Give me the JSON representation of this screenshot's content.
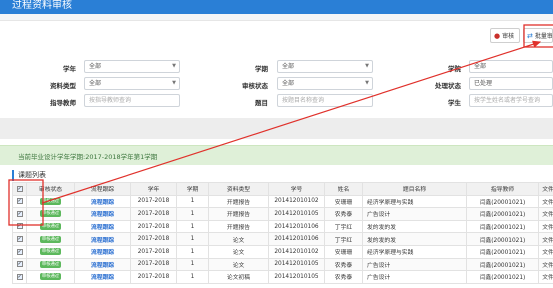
{
  "page": {
    "title": "过程资料审核"
  },
  "toolbar": {
    "review_label": "审核",
    "batch_label": "批量审核",
    "review_icon": "drop-icon",
    "batch_icon": "swap-icon"
  },
  "filters": {
    "year_label": "学年",
    "year_value": "全部",
    "term_label": "学期",
    "term_value": "全部",
    "college_label": "学院",
    "college_value": "全部",
    "type_label": "资料类型",
    "type_value": "全部",
    "status_label": "审核状态",
    "status_value": "全部",
    "handle_label": "处理状态",
    "handle_value": "已处理",
    "teacher_label": "指导教师",
    "teacher_placeholder": "按指导教师查询",
    "topic_label": "题目",
    "topic_placeholder": "按题目名称查询",
    "student_label": "学生",
    "student_placeholder": "按学生姓名或者学号查询"
  },
  "banner": {
    "text": "当前毕业设计学年学期:2017-2018学年第1学期"
  },
  "list": {
    "title": "课题列表"
  },
  "table": {
    "headers": [
      "",
      "审核状态",
      "流程跟踪",
      "学年",
      "学期",
      "资料类型",
      "学号",
      "姓名",
      "题目名称",
      "指导教师",
      "文件"
    ],
    "rows": [
      {
        "status": "审核通过",
        "track": "流程跟踪",
        "year": "2017-2018",
        "term": "1",
        "type": "开题报告",
        "sid": "201412010102",
        "name": "安珊珊",
        "topic": "经济学原理与实践",
        "teacher": "闫鑫(20001021)",
        "file": "文件"
      },
      {
        "status": "审核通过",
        "track": "流程跟踪",
        "year": "2017-2018",
        "term": "1",
        "type": "开题报告",
        "sid": "201412010105",
        "name": "农秀泰",
        "topic": "广告设计",
        "teacher": "闫鑫(20001021)",
        "file": "文件"
      },
      {
        "status": "审核通过",
        "track": "流程跟踪",
        "year": "2017-2018",
        "term": "1",
        "type": "开题报告",
        "sid": "201412010106",
        "name": "丁宇红",
        "topic": "发的发的发",
        "teacher": "闫鑫(20001021)",
        "file": "文件"
      },
      {
        "status": "审核通过",
        "track": "流程跟踪",
        "year": "2017-2018",
        "term": "1",
        "type": "论文",
        "sid": "201412010106",
        "name": "丁宇红",
        "topic": "发的发的发",
        "teacher": "闫鑫(20001021)",
        "file": "文件"
      },
      {
        "status": "审核通过",
        "track": "流程跟踪",
        "year": "2017-2018",
        "term": "1",
        "type": "论文",
        "sid": "201412010102",
        "name": "安珊珊",
        "topic": "经济学原理与实践",
        "teacher": "闫鑫(20001021)",
        "file": "文件"
      },
      {
        "status": "审核通过",
        "track": "流程跟踪",
        "year": "2017-2018",
        "term": "1",
        "type": "论文",
        "sid": "201412010105",
        "name": "农秀泰",
        "topic": "广告设计",
        "teacher": "闫鑫(20001021)",
        "file": "文件"
      },
      {
        "status": "审核通过",
        "track": "流程跟踪",
        "year": "2017-2018",
        "term": "1",
        "type": "论文初稿",
        "sid": "201412010105",
        "name": "农秀泰",
        "topic": "广告设计",
        "teacher": "闫鑫(20001021)",
        "file": "文件"
      }
    ]
  },
  "colors": {
    "accent": "#2a7fd6",
    "annotation": "#e0312b",
    "success": "#5cb85c"
  }
}
